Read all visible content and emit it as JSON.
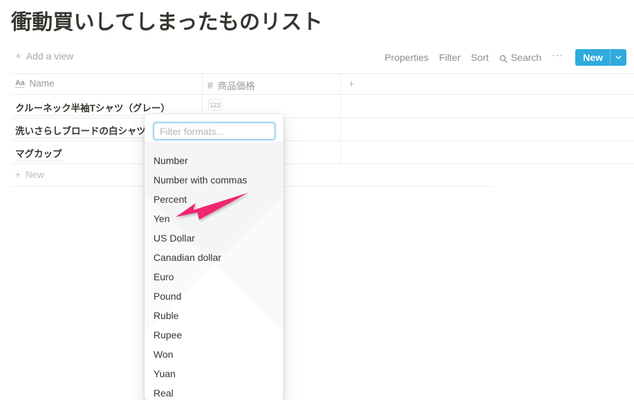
{
  "page": {
    "title": "衝動買いしてしまったものリスト"
  },
  "toolbar": {
    "add_view_label": "Add a view",
    "add_view_icon": "plus-icon",
    "properties_label": "Properties",
    "filter_label": "Filter",
    "sort_label": "Sort",
    "search_label": "Search",
    "search_icon": "search-icon",
    "more_label": "···",
    "more_icon": "ellipsis-icon",
    "new_label": "New",
    "new_chevron_icon": "chevron-down-icon",
    "accent_color": "#2eaadc"
  },
  "table": {
    "columns": [
      {
        "label": "Name",
        "icon": "text-type-icon",
        "icon_text": "Aa"
      },
      {
        "label": "商品価格",
        "icon": "number-type-icon",
        "icon_text": "#"
      }
    ],
    "add_column_icon": "plus-icon",
    "rows": [
      {
        "name": "クルーネック半袖Tシャツ（グレー）",
        "price": ""
      },
      {
        "name": "洗いさらしブロードの白シャツ",
        "price": ""
      },
      {
        "name": "マグカップ",
        "price": ""
      }
    ],
    "number_badge_label": "123",
    "new_row_label": "New",
    "new_row_icon": "plus-icon"
  },
  "dropdown": {
    "search_placeholder": "Filter formats...",
    "search_value": "",
    "items": [
      {
        "label": "Number"
      },
      {
        "label": "Number with commas"
      },
      {
        "label": "Percent"
      },
      {
        "label": "Yen"
      },
      {
        "label": "US Dollar"
      },
      {
        "label": "Canadian dollar"
      },
      {
        "label": "Euro"
      },
      {
        "label": "Pound"
      },
      {
        "label": "Ruble"
      },
      {
        "label": "Rupee"
      },
      {
        "label": "Won"
      },
      {
        "label": "Yuan"
      },
      {
        "label": "Real"
      }
    ]
  },
  "annotation": {
    "arrow_color": "#f0256f",
    "arrow_target": "Yen"
  }
}
